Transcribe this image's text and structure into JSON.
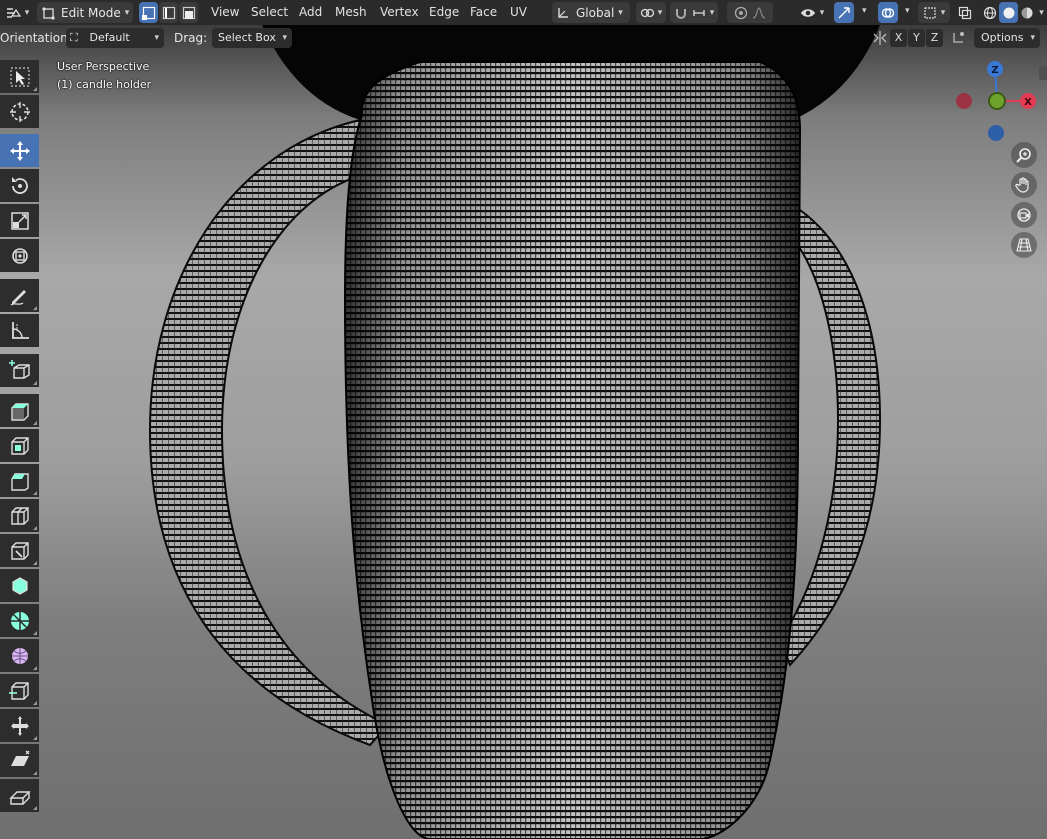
{
  "header": {
    "mode_label": "Edit Mode",
    "menus": [
      "View",
      "Select",
      "Add",
      "Mesh",
      "Vertex",
      "Edge",
      "Face",
      "UV"
    ],
    "transform_orientation": "Global"
  },
  "tool_header": {
    "orientation_label": "Orientation:",
    "orientation_value": "Default",
    "drag_label": "Drag:",
    "drag_value": "Select Box",
    "axes": [
      "X",
      "Y",
      "Z"
    ],
    "options_label": "Options"
  },
  "viewport": {
    "view_name": "User Perspective",
    "object_name": "(1) candle holder"
  },
  "gizmo": {
    "x_label": "X",
    "z_label": "Z"
  },
  "colors": {
    "accent": "#4772b3",
    "axis_x": "#e43a52",
    "axis_y": "#6fa22c",
    "axis_z": "#3a78d6"
  },
  "toolbar": {
    "tools": [
      "select-box-icon",
      "cursor-icon",
      "move-icon",
      "rotate-icon",
      "scale-icon",
      "transform-icon",
      "annotate-icon",
      "measure-icon",
      "add-cube-icon",
      "extrude-icon",
      "inset-icon",
      "bevel-icon",
      "loop-cut-icon",
      "knife-icon",
      "poly-build-icon",
      "spin-icon",
      "smooth-icon",
      "edge-slide-icon",
      "shrink-fatten-icon",
      "shear-icon",
      "rip-icon"
    ],
    "active_tool": "move-icon"
  }
}
